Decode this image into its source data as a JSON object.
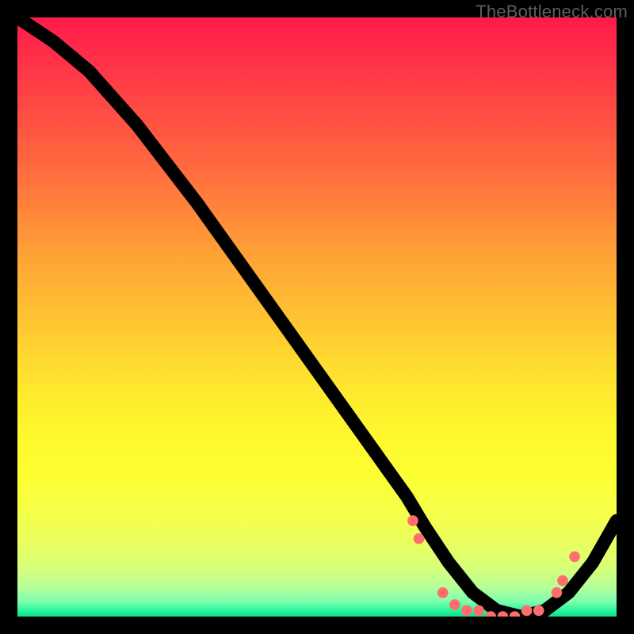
{
  "watermark": "TheBottleneck.com",
  "colors": {
    "background": "#000000",
    "curve": "#000000",
    "marker": "#ff6d6d",
    "gradient_top": "#ff1a4b",
    "gradient_bottom": "#0be08c"
  },
  "chart_data": {
    "type": "line",
    "title": "",
    "xlabel": "",
    "ylabel": "",
    "xlim": [
      0,
      100
    ],
    "ylim": [
      0,
      100
    ],
    "grid": false,
    "legend": false,
    "series": [
      {
        "name": "curve",
        "x": [
          0,
          6,
          12,
          20,
          30,
          40,
          50,
          60,
          65,
          68,
          72,
          76,
          80,
          84,
          88,
          92,
          96,
          100
        ],
        "y": [
          100,
          96,
          91,
          82,
          69,
          55,
          41,
          27,
          20,
          15,
          9,
          4,
          1,
          0,
          1,
          4,
          9,
          16
        ]
      }
    ],
    "markers": {
      "name": "cluster",
      "x": [
        66,
        67,
        71,
        73,
        75,
        77,
        79,
        81,
        83,
        85,
        87,
        90,
        91,
        93
      ],
      "y": [
        16,
        13,
        4,
        2,
        1,
        1,
        0,
        0,
        0,
        1,
        1,
        4,
        6,
        10
      ]
    }
  }
}
